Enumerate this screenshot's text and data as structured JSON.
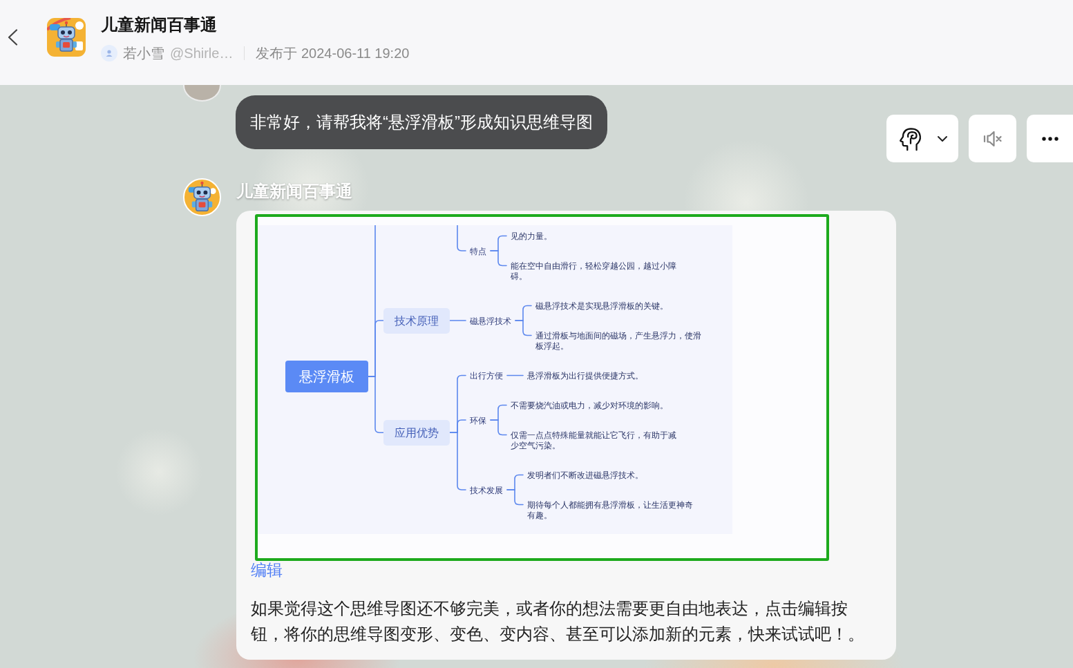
{
  "header": {
    "title": "儿童新闻百事通",
    "author": {
      "name": "若小雪",
      "handle": "@Shirle…"
    },
    "published": "发布于 2024-06-11 19:20"
  },
  "toolbar": [
    {
      "kind": "persona"
    },
    {
      "kind": "mute"
    },
    {
      "kind": "more"
    }
  ],
  "messages": [
    {
      "kind": "user",
      "text": "非常好，请帮我将“悬浮滑板”形成知识思维导图"
    },
    {
      "kind": "bot",
      "sender": "儿童新闻百事通",
      "mind_map": {
        "root": "悬浮滑板",
        "children": [
          {
            "children": [
              {
                "label": "特点",
                "children": [
                  {
                    "label": "见的力量。"
                  },
                  {
                    "label": "能在空中自由滑行，轻松穿越公园，越过小障碍。"
                  }
                ]
              }
            ]
          },
          {
            "label": "技术原理",
            "children": [
              {
                "label": "磁悬浮技术",
                "children": [
                  {
                    "label": "磁悬浮技术是实现悬浮滑板的关键。"
                  },
                  {
                    "label": "通过滑板与地面间的磁场，产生悬浮力，使滑板浮起。"
                  }
                ]
              }
            ]
          },
          {
            "label": "应用优势",
            "children": [
              {
                "label": "出行方便",
                "children": [
                  {
                    "label": "悬浮滑板为出行提供便捷方式。"
                  }
                ]
              },
              {
                "label": "环保",
                "children": [
                  {
                    "label": "不需要烧汽油或电力，减少对环境的影响。"
                  },
                  {
                    "label": "仅需一点点特殊能量就能让它飞行，有助于减少空气污染。"
                  }
                ]
              },
              {
                "label": "技术发展",
                "children": [
                  {
                    "label": "发明者们不断改进磁悬浮技术。"
                  },
                  {
                    "label": "期待每个人都能拥有悬浮滑板，让生活更神奇有趣。"
                  }
                ]
              }
            ]
          }
        ]
      },
      "edit_link": "编辑",
      "text": "如果觉得这个思维导图还不够完美，或者你的想法需要更自由地表达，点击编辑按钮，将你的思维导图变形、变色、变内容、甚至可以添加新的元素，快来试试吧！。"
    }
  ]
}
